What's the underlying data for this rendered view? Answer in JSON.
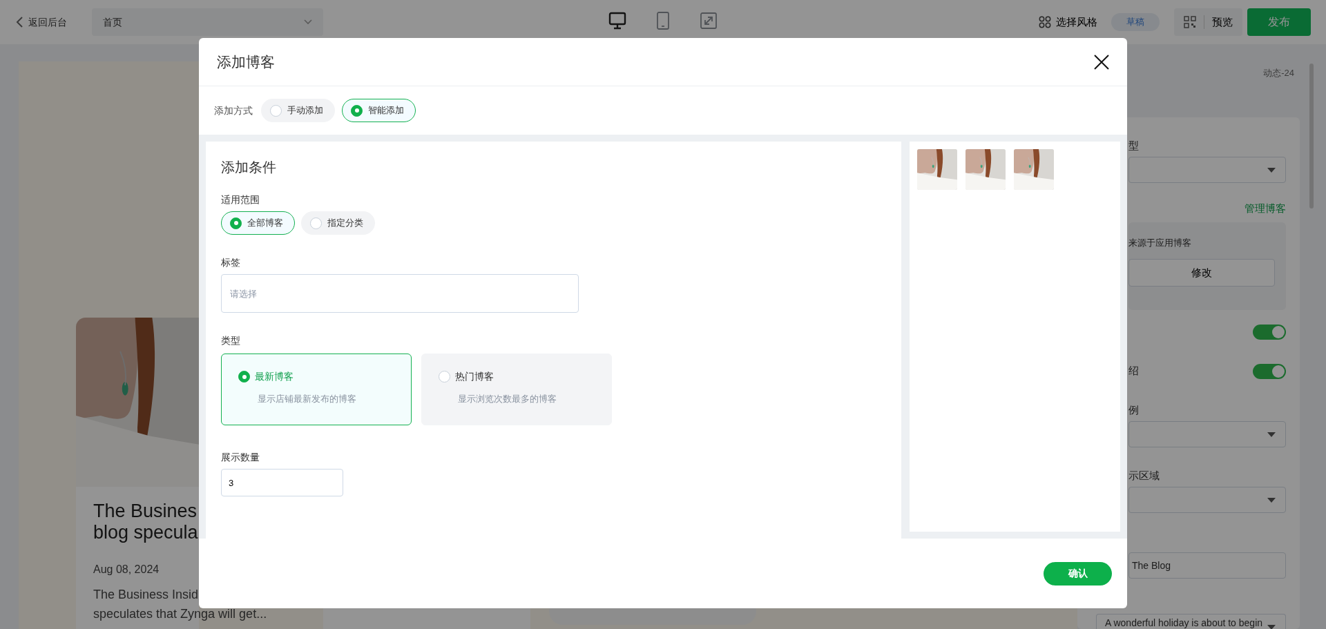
{
  "topbar": {
    "back": "返回后台",
    "page_select": "首页",
    "devices": [
      {
        "kind": "desktop",
        "selected": true
      },
      {
        "kind": "tablet",
        "selected": false
      },
      {
        "kind": "fullscreen",
        "selected": false
      }
    ],
    "style_button": "选择风格",
    "status_badge": "草稿",
    "preview_button": "预览",
    "publish_button": "发布"
  },
  "preview": {
    "post": {
      "image": {
        "kind": "picture"
      },
      "title_lines": [
        "The Busines",
        "blog specula"
      ],
      "date": "Aug 08, 2024",
      "excerpt_lines": [
        "The Business Insid",
        "speculates that Zynga will get..."
      ]
    }
  },
  "settings": {
    "section_id": "动态-24",
    "fields": [
      {
        "kind": "select",
        "label": "型"
      },
      {
        "kind": "link",
        "text": "管理博客"
      },
      {
        "kind": "source",
        "text": "来源于应用博客",
        "button": "修改"
      },
      {
        "kind": "toggle",
        "on": true
      },
      {
        "kind": "toggle",
        "label": "绍",
        "on": true
      },
      {
        "kind": "select",
        "label": "例"
      },
      {
        "kind": "select",
        "label": "示区域"
      },
      {
        "kind": "input",
        "value": "The Blog"
      },
      {
        "kind": "select",
        "value": "A wonderful holiday is about to begin"
      }
    ]
  },
  "modal": {
    "title": "添加博客",
    "add_mode": {
      "label": "添加方式",
      "options": [
        {
          "label": "手动添加",
          "selected": false
        },
        {
          "label": "智能添加",
          "selected": true
        }
      ]
    },
    "conditions": {
      "title": "添加条件",
      "scope": {
        "label": "适用范围",
        "options": [
          {
            "label": "全部博客",
            "selected": true
          },
          {
            "label": "指定分类",
            "selected": false
          }
        ]
      },
      "tags": {
        "label": "标签",
        "placeholder": "请选择"
      },
      "type": {
        "label": "类型",
        "options": [
          {
            "title": "最新博客",
            "description": "显示店铺最新发布的博客",
            "selected": true
          },
          {
            "title": "热门博客",
            "description": "显示浏览次数最多的博客",
            "selected": false
          }
        ]
      },
      "count": {
        "label": "展示数量",
        "value": "3"
      }
    },
    "thumbnails": [
      {
        "kind": "picture"
      },
      {
        "kind": "picture"
      },
      {
        "kind": "picture"
      }
    ],
    "confirm_button": "确认"
  }
}
